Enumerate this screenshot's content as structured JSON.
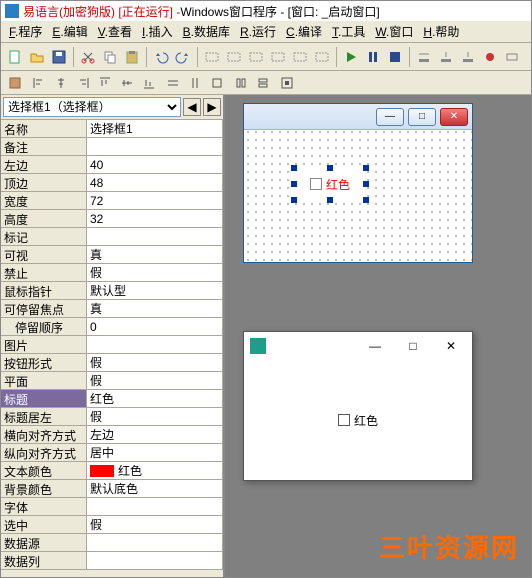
{
  "title": {
    "app_prefix": "易语言(加密狗版) [正在运行] - ",
    "doc": "Windows窗口程序 - [窗口: _启动窗口]"
  },
  "menu": [
    "F.程序",
    "E.编辑",
    "V.查看",
    "I.插入",
    "B.数据库",
    "R.运行",
    "C.编译",
    "T.工具",
    "W.窗口",
    "H.帮助"
  ],
  "selector": {
    "value": "选择框1（选择框）"
  },
  "props": [
    {
      "k": "名称",
      "v": "选择框1"
    },
    {
      "k": "备注",
      "v": ""
    },
    {
      "k": "左边",
      "v": "40"
    },
    {
      "k": "顶边",
      "v": "48"
    },
    {
      "k": "宽度",
      "v": "72"
    },
    {
      "k": "高度",
      "v": "32"
    },
    {
      "k": "标记",
      "v": ""
    },
    {
      "k": "可视",
      "v": "真"
    },
    {
      "k": "禁止",
      "v": "假"
    },
    {
      "k": "鼠标指针",
      "v": "默认型"
    },
    {
      "k": "可停留焦点",
      "v": "真"
    },
    {
      "k": "停留顺序",
      "v": "0",
      "indent": true
    },
    {
      "k": "图片",
      "v": ""
    },
    {
      "k": "按钮形式",
      "v": "假"
    },
    {
      "k": "平面",
      "v": "假"
    },
    {
      "k": "标题",
      "v": "红色",
      "selected": true
    },
    {
      "k": "标题居左",
      "v": "假"
    },
    {
      "k": "横向对齐方式",
      "v": "左边"
    },
    {
      "k": "纵向对齐方式",
      "v": "居中"
    },
    {
      "k": "文本颜色",
      "v": "红色",
      "color": "#ff0000"
    },
    {
      "k": "背景颜色",
      "v": "默认底色"
    },
    {
      "k": "字体",
      "v": ""
    },
    {
      "k": "选中",
      "v": "假"
    },
    {
      "k": "数据源",
      "v": ""
    },
    {
      "k": "数据列",
      "v": ""
    }
  ],
  "design": {
    "checkbox_label": "红色"
  },
  "runtime": {
    "checkbox_label": "红色"
  },
  "watermark": "三叶资源网"
}
